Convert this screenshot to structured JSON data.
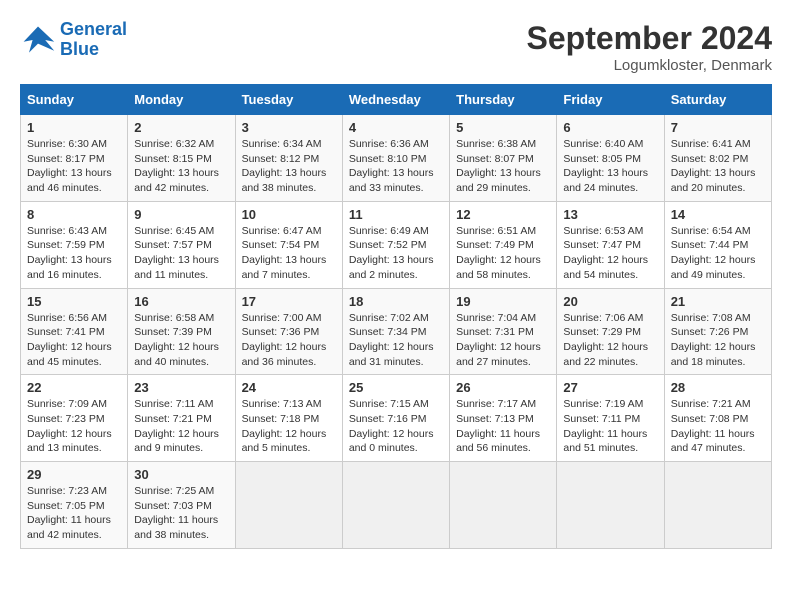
{
  "logo": {
    "line1": "General",
    "line2": "Blue"
  },
  "title": "September 2024",
  "location": "Logumkloster, Denmark",
  "days_header": [
    "Sunday",
    "Monday",
    "Tuesday",
    "Wednesday",
    "Thursday",
    "Friday",
    "Saturday"
  ],
  "weeks": [
    [
      {
        "day": "1",
        "info": "Sunrise: 6:30 AM\nSunset: 8:17 PM\nDaylight: 13 hours\nand 46 minutes."
      },
      {
        "day": "2",
        "info": "Sunrise: 6:32 AM\nSunset: 8:15 PM\nDaylight: 13 hours\nand 42 minutes."
      },
      {
        "day": "3",
        "info": "Sunrise: 6:34 AM\nSunset: 8:12 PM\nDaylight: 13 hours\nand 38 minutes."
      },
      {
        "day": "4",
        "info": "Sunrise: 6:36 AM\nSunset: 8:10 PM\nDaylight: 13 hours\nand 33 minutes."
      },
      {
        "day": "5",
        "info": "Sunrise: 6:38 AM\nSunset: 8:07 PM\nDaylight: 13 hours\nand 29 minutes."
      },
      {
        "day": "6",
        "info": "Sunrise: 6:40 AM\nSunset: 8:05 PM\nDaylight: 13 hours\nand 24 minutes."
      },
      {
        "day": "7",
        "info": "Sunrise: 6:41 AM\nSunset: 8:02 PM\nDaylight: 13 hours\nand 20 minutes."
      }
    ],
    [
      {
        "day": "8",
        "info": "Sunrise: 6:43 AM\nSunset: 7:59 PM\nDaylight: 13 hours\nand 16 minutes."
      },
      {
        "day": "9",
        "info": "Sunrise: 6:45 AM\nSunset: 7:57 PM\nDaylight: 13 hours\nand 11 minutes."
      },
      {
        "day": "10",
        "info": "Sunrise: 6:47 AM\nSunset: 7:54 PM\nDaylight: 13 hours\nand 7 minutes."
      },
      {
        "day": "11",
        "info": "Sunrise: 6:49 AM\nSunset: 7:52 PM\nDaylight: 13 hours\nand 2 minutes."
      },
      {
        "day": "12",
        "info": "Sunrise: 6:51 AM\nSunset: 7:49 PM\nDaylight: 12 hours\nand 58 minutes."
      },
      {
        "day": "13",
        "info": "Sunrise: 6:53 AM\nSunset: 7:47 PM\nDaylight: 12 hours\nand 54 minutes."
      },
      {
        "day": "14",
        "info": "Sunrise: 6:54 AM\nSunset: 7:44 PM\nDaylight: 12 hours\nand 49 minutes."
      }
    ],
    [
      {
        "day": "15",
        "info": "Sunrise: 6:56 AM\nSunset: 7:41 PM\nDaylight: 12 hours\nand 45 minutes."
      },
      {
        "day": "16",
        "info": "Sunrise: 6:58 AM\nSunset: 7:39 PM\nDaylight: 12 hours\nand 40 minutes."
      },
      {
        "day": "17",
        "info": "Sunrise: 7:00 AM\nSunset: 7:36 PM\nDaylight: 12 hours\nand 36 minutes."
      },
      {
        "day": "18",
        "info": "Sunrise: 7:02 AM\nSunset: 7:34 PM\nDaylight: 12 hours\nand 31 minutes."
      },
      {
        "day": "19",
        "info": "Sunrise: 7:04 AM\nSunset: 7:31 PM\nDaylight: 12 hours\nand 27 minutes."
      },
      {
        "day": "20",
        "info": "Sunrise: 7:06 AM\nSunset: 7:29 PM\nDaylight: 12 hours\nand 22 minutes."
      },
      {
        "day": "21",
        "info": "Sunrise: 7:08 AM\nSunset: 7:26 PM\nDaylight: 12 hours\nand 18 minutes."
      }
    ],
    [
      {
        "day": "22",
        "info": "Sunrise: 7:09 AM\nSunset: 7:23 PM\nDaylight: 12 hours\nand 13 minutes."
      },
      {
        "day": "23",
        "info": "Sunrise: 7:11 AM\nSunset: 7:21 PM\nDaylight: 12 hours\nand 9 minutes."
      },
      {
        "day": "24",
        "info": "Sunrise: 7:13 AM\nSunset: 7:18 PM\nDaylight: 12 hours\nand 5 minutes."
      },
      {
        "day": "25",
        "info": "Sunrise: 7:15 AM\nSunset: 7:16 PM\nDaylight: 12 hours\nand 0 minutes."
      },
      {
        "day": "26",
        "info": "Sunrise: 7:17 AM\nSunset: 7:13 PM\nDaylight: 11 hours\nand 56 minutes."
      },
      {
        "day": "27",
        "info": "Sunrise: 7:19 AM\nSunset: 7:11 PM\nDaylight: 11 hours\nand 51 minutes."
      },
      {
        "day": "28",
        "info": "Sunrise: 7:21 AM\nSunset: 7:08 PM\nDaylight: 11 hours\nand 47 minutes."
      }
    ],
    [
      {
        "day": "29",
        "info": "Sunrise: 7:23 AM\nSunset: 7:05 PM\nDaylight: 11 hours\nand 42 minutes."
      },
      {
        "day": "30",
        "info": "Sunrise: 7:25 AM\nSunset: 7:03 PM\nDaylight: 11 hours\nand 38 minutes."
      },
      null,
      null,
      null,
      null,
      null
    ]
  ]
}
